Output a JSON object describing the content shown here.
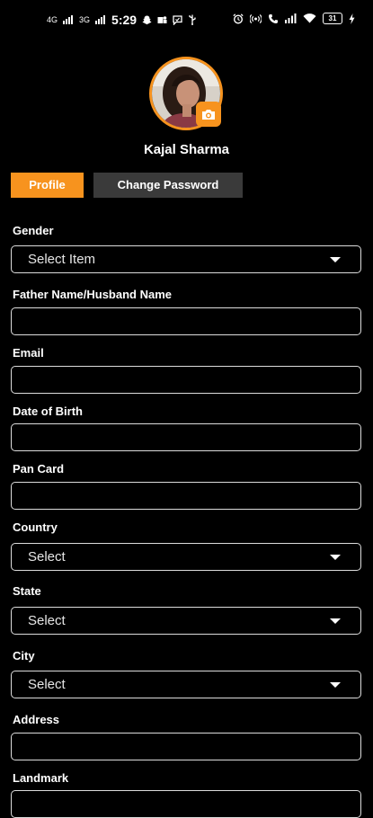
{
  "status_bar": {
    "net_1": "4G",
    "net_2": "3G",
    "time": "5:29",
    "battery": "31"
  },
  "profile": {
    "name": "Kajal Sharma"
  },
  "tabs": [
    {
      "label": "Profile",
      "active": true
    },
    {
      "label": "Change Password",
      "active": false
    }
  ],
  "form": {
    "gender": {
      "label": "Gender",
      "value": "Select Item"
    },
    "father_name": {
      "label": "Father Name/Husband Name",
      "value": ""
    },
    "email": {
      "label": "Email",
      "value": ""
    },
    "dob": {
      "label": "Date of Birth",
      "value": ""
    },
    "pan": {
      "label": "Pan Card",
      "value": ""
    },
    "country": {
      "label": "Country",
      "value": "Select"
    },
    "state": {
      "label": "State",
      "value": "Select"
    },
    "city": {
      "label": "City",
      "value": "Select"
    },
    "address": {
      "label": "Address",
      "value": ""
    },
    "landmark": {
      "label": "Landmark",
      "value": ""
    }
  },
  "colors": {
    "accent": "#f7931e",
    "background": "#000000",
    "inactive_tab": "#3a3a3a"
  }
}
